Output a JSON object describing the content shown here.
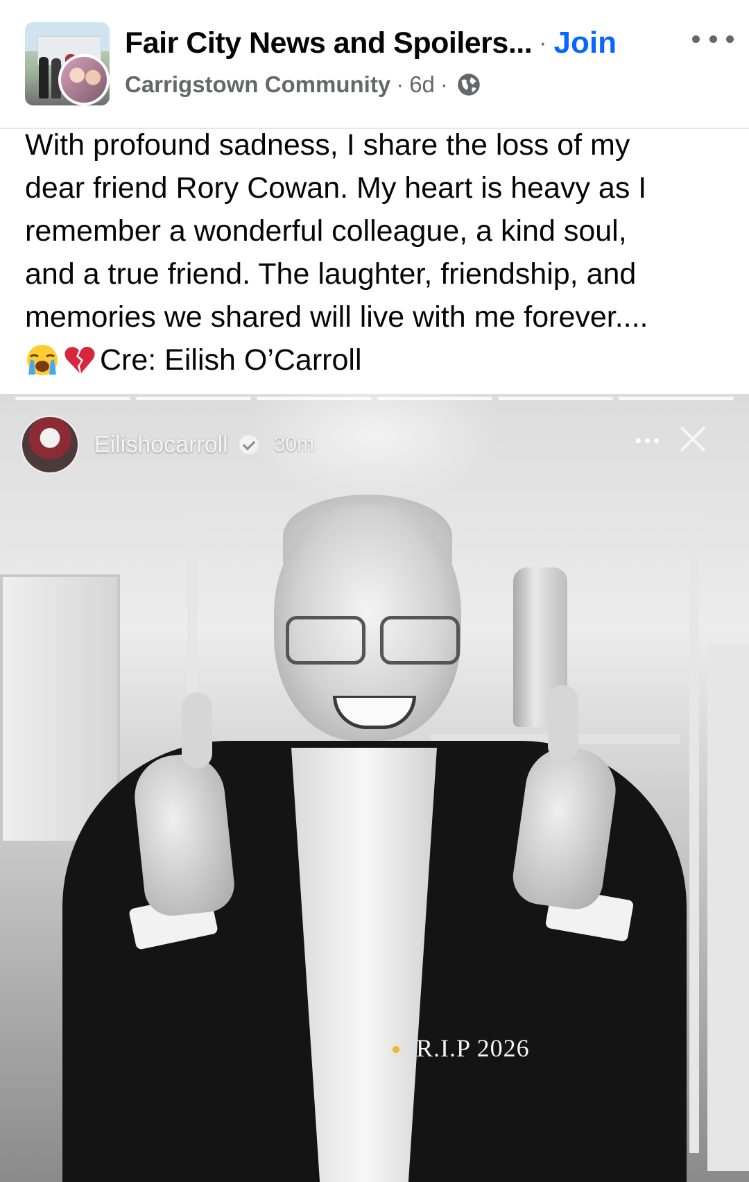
{
  "post_header": {
    "group_name": "Fair City News and Spoilers...",
    "separator": "·",
    "join_label": "Join",
    "author": "Carrigstown Community",
    "timestamp": "6d",
    "privacy_icon": "globe-icon",
    "more_icon": "more-options-icon"
  },
  "post_body": {
    "lines": [
      "With profound sadness, I share the loss of my",
      "dear friend Rory Cowan. My heart is heavy as I",
      "remember a wonderful colleague, a kind soul,",
      "and a true friend. The laughter, friendship, and",
      "memories we shared will live with me forever...."
    ],
    "credit": "Cre: Eilish O’Carroll",
    "emojis": [
      "loudly-crying-face",
      "broken-heart"
    ]
  },
  "story": {
    "username": "Eilishocarroll",
    "time": "30m",
    "overlay_text": "R.I.P 2026",
    "progress_segments": 6
  },
  "colors": {
    "accent": "#0866ff",
    "secondary_text": "#65676b",
    "primary_text": "#050505"
  }
}
